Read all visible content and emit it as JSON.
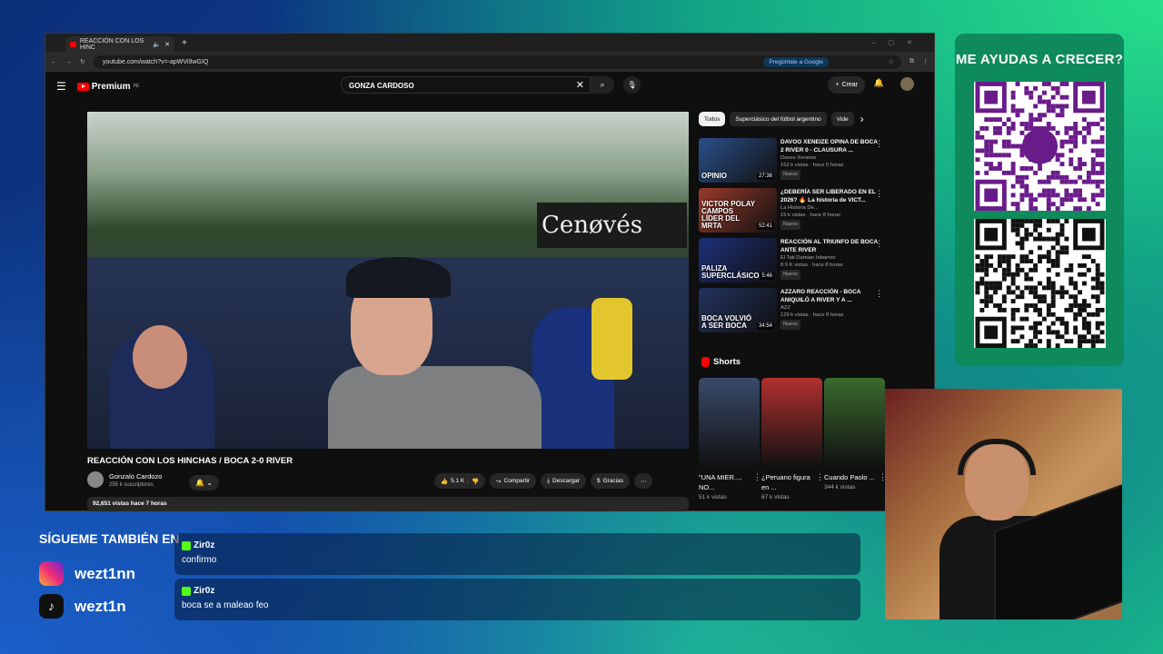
{
  "browser": {
    "tab_title": "REACCIÓN CON LOS HINC",
    "url": "youtube.com/watch?v=-apWVi9wGIQ",
    "ask_google": "Pregúntale a Google"
  },
  "youtube": {
    "logo_text": "Premium",
    "logo_sup": "PE",
    "search_value": "GONZA CARDOSO",
    "create_label": "Crear",
    "video": {
      "sign_text": "Cenøvés",
      "title": "REACCIÓN CON LOS HINCHAS / BOCA 2-0 RIVER",
      "channel": "Gonzalo Cardozo",
      "subscribers": "255 k suscriptores",
      "likes": "5.1 K",
      "share": "Compartir",
      "download": "Descargar",
      "thanks": "Gracias",
      "views_date": "92,651 vistas  hace 7 horas"
    },
    "chips": [
      "Todos",
      "Superclásico del fútbol argentino",
      "Vide"
    ],
    "recommendations": [
      {
        "title": "DAVOO XENEIZE OPINA DE BOCA 2 RIVER 0 - CLAUSURA ...",
        "channel": "Davoo Xeneize",
        "meta": "162 k vistas · hace 5 horas",
        "badge": "Nuevo",
        "duration": "27:36",
        "thumb_text": "OPINIO",
        "color": "#2b4f8a"
      },
      {
        "title": "¿DEBERÍA SER LIBERADO EN EL 2026? 🔥 La historia de VICT...",
        "channel": "La Historia De...",
        "meta": "15 k vistas · hace 8 horas",
        "badge": "Nuevo",
        "duration": "52:41",
        "thumb_text": "VICTOR POLAY CAMPOS LÍDER DEL MRTA",
        "color": "#9a3a2a"
      },
      {
        "title": "REACCIÓN AL TRIUNFO DE BOCA ANTE RIVER",
        "channel": "El Tati Damian Iribarren",
        "meta": "8.9 K vistas · hace 8 horas",
        "badge": "Nuevo",
        "duration": "5:46",
        "thumb_text": "PALIZA SUPERCLÁSICO",
        "color": "#1d2f7a"
      },
      {
        "title": "AZZARO REACCIÓN - BOCA ANIQUILÓ A RIVER Y A ...",
        "channel": "AZZ",
        "meta": "129 k vistas · hace 8 horas",
        "badge": "Nuevo",
        "duration": "34:54",
        "thumb_text": "BOCA VOLVIÓ A SER BOCA",
        "color": "#22325e"
      }
    ],
    "shorts_label": "Shorts",
    "shorts": [
      {
        "title": "\"UNA MIER..., NO...",
        "views": "51 k vistas",
        "color": "#3a4a6a"
      },
      {
        "title": "¿Peruano figura en ...",
        "views": "67 k vistas",
        "color": "#b23030"
      },
      {
        "title": "Cuando Paolo ...",
        "views": "344 k vistas",
        "color": "#3b6a2f"
      }
    ]
  },
  "overlay": {
    "qr_title": "ME AYUDAS A CRECER?",
    "follow_title": "SÍGUEME TAMBIÉN EN",
    "instagram": "wezt1nn",
    "tiktok": "wezt1n",
    "chat": [
      {
        "user": "Zir0z",
        "message": "confirmo"
      },
      {
        "user": "Zir0z",
        "message": "boca se a maleao feo"
      }
    ]
  }
}
